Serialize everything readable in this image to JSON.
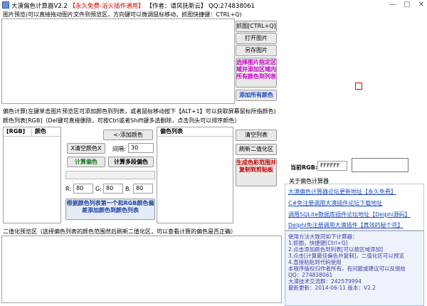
{
  "window": {
    "title_prefix": "大漠偏色计算器V2.2",
    "title_free": "【永久免费-浴火插件通用】",
    "title_author": "【作者：请风抚新云】",
    "title_qq": "QQ:274838061",
    "minimize_glyph": "—",
    "maximize_glyph": "□",
    "close_glyph": "✕"
  },
  "preview": {
    "label": "图片预览(可以直接拖动图片文件到预览区，方向键可以微调鼠标移动，抓图快捷键：CTRL+Q)",
    "buttons": {
      "capture": "抓图[CTRL+Q]",
      "open": "打开图片",
      "save_as": "另存图片",
      "pick_region": "选择图片指定区域并添加区域内所有颜色到列表",
      "add_all": "添加所有颜色"
    }
  },
  "color_calc": {
    "section_label": "偏色计算(左键单击图片预览区可添加颜色到列表，或者鼠标移动按下【ALT+1】可以获取屏幕鼠标所指颜色)",
    "list_label": "颜色列表[RGB]（Del键可直接删除，可按Ctrl或者Shift键多选删除，点击列头可以排序颜色）",
    "table_headers": [
      "[RGB]",
      "颜色"
    ],
    "add_color_btn": "<-添加颜色",
    "clear_color_btn": "X清空颜色X",
    "interval_label": "间隔:",
    "interval_value": "30",
    "calc_btn": "计算偏色",
    "multi_calc_btn": "计算多段偏色",
    "r_label": "R:",
    "r_value": "80",
    "g_label": "G:",
    "g_value": "80",
    "b_label": "B:",
    "b_value": "80",
    "gen_btn": "根据颜色列表第一个和RGB颜色偏差添加颜色到颜色列表",
    "progress": 0
  },
  "offset_list": {
    "header": "偏色列表",
    "clear_btn": "清空列表",
    "refresh_btn": "刷新二值化区",
    "generate_btn": "生成色彩范围并复制到剪贴板"
  },
  "binary": {
    "label": "二值化预览区（选择偏色列表的颜色范围然后刷新二值化区，可以查看计算的偏色是否正确）"
  },
  "current": {
    "rgb_label": "当前RGB:",
    "rgb_value": "FFFFFF"
  },
  "about": {
    "title": "关于偏色计算器",
    "links": [
      "大漠偏色计算器论坛更新地址【永久免费】",
      "C#免注册调用大漠插件论坛下载地址",
      "调用SQLite数据库插件论坛地址【Delphi源码】",
      "Delphi免注册调用大漠插件【真效的秘个花】"
    ]
  },
  "info": {
    "lines": [
      "使用方法大致同如下计算器：",
      "1.抓图，快捷键[Ctrl+Q]",
      "2.点击添加颜色到列表[可以按区域添加]",
      "3.点击[计算最佳偏色并复制]，二值化区可以预览",
      "4.直接粘贴到代码使用",
      "",
      "本程序版权归作者所有，有问题或建议可以反馈给",
      "QQ：274838061",
      "大漠技术交流群：242579994",
      "最新更新：2014-06-11 版本：V2.2"
    ]
  },
  "colors": {
    "accent_red": "#cc0000",
    "magenta": "#cc00cc",
    "blue_link": "#1a4bc4",
    "green_text": "#006600",
    "calc_green": "#1a7a1a",
    "gen_blue": "#1f3fa0"
  }
}
